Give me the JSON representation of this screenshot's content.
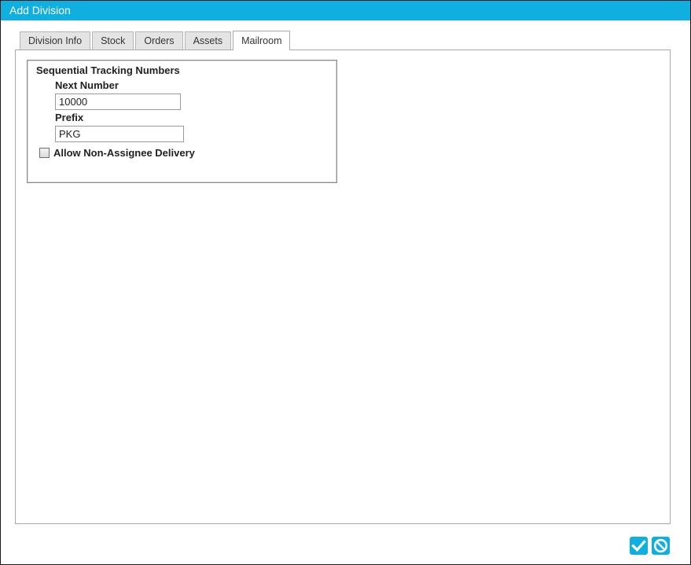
{
  "window": {
    "title": "Add Division"
  },
  "tabs": [
    {
      "label": "Division Info",
      "active": false
    },
    {
      "label": "Stock",
      "active": false
    },
    {
      "label": "Orders",
      "active": false
    },
    {
      "label": "Assets",
      "active": false
    },
    {
      "label": "Mailroom",
      "active": true
    }
  ],
  "mailroom": {
    "group_title": "Sequential Tracking Numbers",
    "next_number": {
      "label": "Next Number",
      "value": "10000"
    },
    "prefix": {
      "label": "Prefix",
      "value": "PKG"
    },
    "allow_non_assignee": {
      "label": "Allow Non-Assignee Delivery",
      "checked": false
    }
  },
  "actions": {
    "save_icon": "checkmark-icon",
    "cancel_icon": "cancel-icon"
  },
  "colors": {
    "accent": "#0fb0e0",
    "tab_inactive": "#e4e4e4",
    "border": "#a9a9a9"
  }
}
